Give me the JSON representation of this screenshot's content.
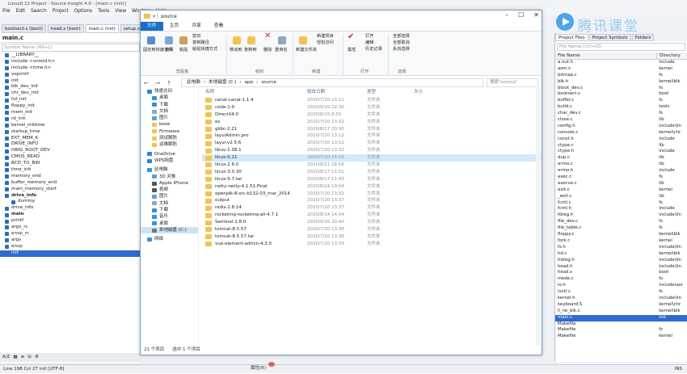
{
  "app": {
    "title": "Linux0.11 Project - Source Insight 4.0 - [main.c (init)]",
    "menu": [
      "File",
      "Edit",
      "Search",
      "Project",
      "Options",
      "Tools",
      "View",
      "Window",
      "Help"
    ],
    "tabs": [
      "bootsect.s (boot)",
      "head.s (boot)",
      "main.c (init)",
      "setup.s (boot)"
    ],
    "active_tab": "main.c (init)",
    "symbol_header": "main.c",
    "symbol_search_placeholder": "Symbol Name (Alt+L)",
    "symbols": [
      "__LIBRARY__",
      "include <unistd.h>",
      "include <time.h>",
      "vsprintf",
      "init",
      "blk_dev_init",
      "chr_dev_init",
      "hd_init",
      "floppy_init",
      "mem_init",
      "rd_init",
      "kernel_mktime",
      "startup_time",
      "EXT_MEM_K",
      "DRIVE_INFO",
      "ORIG_ROOT_DEV",
      "CMOS_READ",
      "BCD_TO_BIN",
      "time_init",
      "memory_end",
      "buffer_memory_end",
      "main_memory_start",
      "drive_info",
      "dummy",
      "drive_info",
      "main",
      "printf",
      "argv_rc",
      "envp_rc",
      "argv",
      "envp",
      "init"
    ],
    "status": {
      "position": "Line 198  Col 27  init [UTF-8]",
      "mode": "INS"
    },
    "right_panel": {
      "tabs": [
        "Project Files",
        "Project Symbols",
        "Folders"
      ],
      "filter_placeholder": "File Name (Ctrl+O)",
      "col_name": "File Name",
      "col_dir": "Directory",
      "files": [
        [
          "a.out.h",
          "include"
        ],
        [
          "asm.s",
          "kernel"
        ],
        [
          "bitmap.c",
          "fs"
        ],
        [
          "blk.h",
          "kernel\\blk"
        ],
        [
          "block_dev.c",
          "fs"
        ],
        [
          "bootsect.s",
          "boot"
        ],
        [
          "buffer.c",
          "fs"
        ],
        [
          "build.c",
          "tools"
        ],
        [
          "char_dev.c",
          "fs"
        ],
        [
          "close.c",
          "lib"
        ],
        [
          "config.h",
          "include\\lin"
        ],
        [
          "console.c",
          "kernel\\chr"
        ],
        [
          "const.h",
          "include"
        ],
        [
          "ctype.c",
          "lib"
        ],
        [
          "ctype.h",
          "include"
        ],
        [
          "dup.c",
          "lib"
        ],
        [
          "errno.c",
          "lib"
        ],
        [
          "errno.h",
          "include"
        ],
        [
          "exec.c",
          "fs"
        ],
        [
          "execve.c",
          "lib"
        ],
        [
          "exit.c",
          "kernel"
        ],
        [
          "_exit.c",
          "lib"
        ],
        [
          "fcntl.c",
          "fs"
        ],
        [
          "fcntl.h",
          "include"
        ],
        [
          "fdreg.h",
          "include\\lin"
        ],
        [
          "file_dev.c",
          "fs"
        ],
        [
          "file_table.c",
          "fs"
        ],
        [
          "floppy.c",
          "kernel\\blk"
        ],
        [
          "fork.c",
          "kernel"
        ],
        [
          "fs.h",
          "include\\lin"
        ],
        [
          "hd.c",
          "kernel\\blk"
        ],
        [
          "hdreg.h",
          "include\\lin"
        ],
        [
          "head.h",
          "include\\lin"
        ],
        [
          "head.s",
          "boot"
        ],
        [
          "inode.c",
          "fs"
        ],
        [
          "io.h",
          "include\\asr"
        ],
        [
          "ioctl.c",
          "fs"
        ],
        [
          "kernel.h",
          "include\\lin"
        ],
        [
          "keyboard.S",
          "kernel\\chr"
        ],
        [
          "ll_rw_blk.c",
          "kernel\\blk"
        ],
        [
          "main.c",
          "init"
        ],
        [
          "Makefile",
          ""
        ],
        [
          "Makefile",
          "fs"
        ],
        [
          "Makefile",
          "kernel"
        ]
      ],
      "selected_file": "main.c"
    },
    "bottom_caption": "属性(R)"
  },
  "watermark": "腾讯课堂",
  "explorer": {
    "title": "source",
    "ribbon_tabs": [
      "文件",
      "主页",
      "共享",
      "查看"
    ],
    "ribbon": {
      "clipboard": {
        "pin": "固定到快速访问",
        "copy": "复制",
        "paste": "粘贴",
        "cut": "剪切",
        "copy_path": "复制路径",
        "paste_shortcut": "粘贴快捷方式",
        "group": "剪贴板"
      },
      "organize": {
        "move_to": "移动到",
        "copy_to": "复制到",
        "delete": "删除",
        "rename": "重命名",
        "group": "组织"
      },
      "new": {
        "new_folder": "新建文件夹",
        "new_item": "新建项目",
        "easy_access": "轻松访问",
        "group": "新建"
      },
      "open": {
        "properties": "属性",
        "open": "打开",
        "edit": "编辑",
        "history": "历史记录",
        "group": "打开"
      },
      "select": {
        "select_all": "全部选择",
        "select_none": "全部取消",
        "invert": "反向选择",
        "group": "选择"
      }
    },
    "breadcrumb": [
      "此电脑",
      "本地磁盘 (C:)",
      "app",
      "source"
    ],
    "search_placeholder": "搜索\"source\"",
    "columns": {
      "name": "名称",
      "date": "修改日期",
      "type": "类型",
      "size": "大小"
    },
    "nav": [
      {
        "label": "快速访问",
        "color": "#2b84d8"
      },
      {
        "label": "桌面",
        "color": "#3a8fd8"
      },
      {
        "label": "下载",
        "color": "#3a8fd8"
      },
      {
        "label": "文档",
        "color": "#8fa7bf"
      },
      {
        "label": "图片",
        "color": "#5aa0e0"
      },
      {
        "label": "book",
        "color": "#f2c350"
      },
      {
        "label": "Firmware",
        "color": "#f2c350"
      },
      {
        "label": "测试脚防",
        "color": "#f2c350"
      },
      {
        "label": "运维脚防",
        "color": "#f2c350"
      },
      {
        "label": "OneDrive",
        "color": "#2b84d8"
      },
      {
        "label": "WPS网盘",
        "color": "#2b84d8"
      },
      {
        "label": "此电脑",
        "color": "#3a8fd8"
      },
      {
        "label": "3D 对象",
        "color": "#5aa0e0"
      },
      {
        "label": "Apple iPhone",
        "color": "#555"
      },
      {
        "label": "视频",
        "color": "#555"
      },
      {
        "label": "图片",
        "color": "#5aa0e0"
      },
      {
        "label": "文档",
        "color": "#8fa7bf"
      },
      {
        "label": "下载",
        "color": "#3a8fd8"
      },
      {
        "label": "音乐",
        "color": "#3a8fd8"
      },
      {
        "label": "桌面",
        "color": "#3a8fd8"
      },
      {
        "label": "本地磁盘 (C:)",
        "color": "#777"
      },
      {
        "label": "网络",
        "color": "#3a8fd8"
      }
    ],
    "files": [
      {
        "name": "canal-canal-1.1.4",
        "date": "2020/7/20 13:12",
        "type": "文件夹"
      },
      {
        "name": "code-1.0",
        "date": "2020/9/10 22:30",
        "type": "文件夹"
      },
      {
        "name": "DirectX4.0",
        "date": "2020/8/15 8:50",
        "type": "文件夹"
      },
      {
        "name": "es",
        "date": "2020/7/20 13:32",
        "type": "文件夹"
      },
      {
        "name": "glibc-2.21",
        "date": "2020/8/17 20:30",
        "type": "文件夹"
      },
      {
        "name": "layuiAdmin.pro",
        "date": "2020/7/20 13:12",
        "type": "文件夹"
      },
      {
        "name": "layui-v2.5.6",
        "date": "2020/7/20 13:12",
        "type": "文件夹"
      },
      {
        "name": "libuv-1.38.1",
        "date": "2020/7/20 13:32",
        "type": "文件夹"
      },
      {
        "name": "linux-0.11",
        "date": "2020/7/20 15:15",
        "type": "文件夹"
      },
      {
        "name": "linux-2.6.0",
        "date": "2020/8/21 16:58",
        "type": "文件夹"
      },
      {
        "name": "linux-3.0.30",
        "date": "2020/8/17 11:51",
        "type": "文件夹"
      },
      {
        "name": "linux-5.7.tar",
        "date": "2020/8/17 11:43",
        "type": "文件夹"
      },
      {
        "name": "netty-netty-4.1.51.Final",
        "date": "2020/8/24 10:54",
        "type": "文件夹"
      },
      {
        "name": "openjdk-8-src-b132-03_mar_2014",
        "date": "2020/7/20 13:32",
        "type": "文件夹"
      },
      {
        "name": "output",
        "date": "2020/7/20 13:37",
        "type": "文件夹"
      },
      {
        "name": "redis-2.8.14",
        "date": "2020/7/20 13:37",
        "type": "文件夹"
      },
      {
        "name": "rocketmq-rocketmq-all-4.7.1",
        "date": "2020/8/14 14:54",
        "type": "文件夹"
      },
      {
        "name": "Sentinel-1.8.0",
        "date": "2020/9/20 20:40",
        "type": "文件夹"
      },
      {
        "name": "tomcat-8.5.57",
        "date": "2020/7/20 13:38",
        "type": "文件夹"
      },
      {
        "name": "tomcat-8.5.57.tar",
        "date": "2020/7/20 13:38",
        "type": "文件夹"
      },
      {
        "name": "vue-element-admin-4.3.0",
        "date": "2020/7/20 13:39",
        "type": "文件夹"
      }
    ],
    "highlight_index": 8,
    "status": {
      "count": "21 个项目",
      "selected": "选中 1 个项目"
    }
  }
}
